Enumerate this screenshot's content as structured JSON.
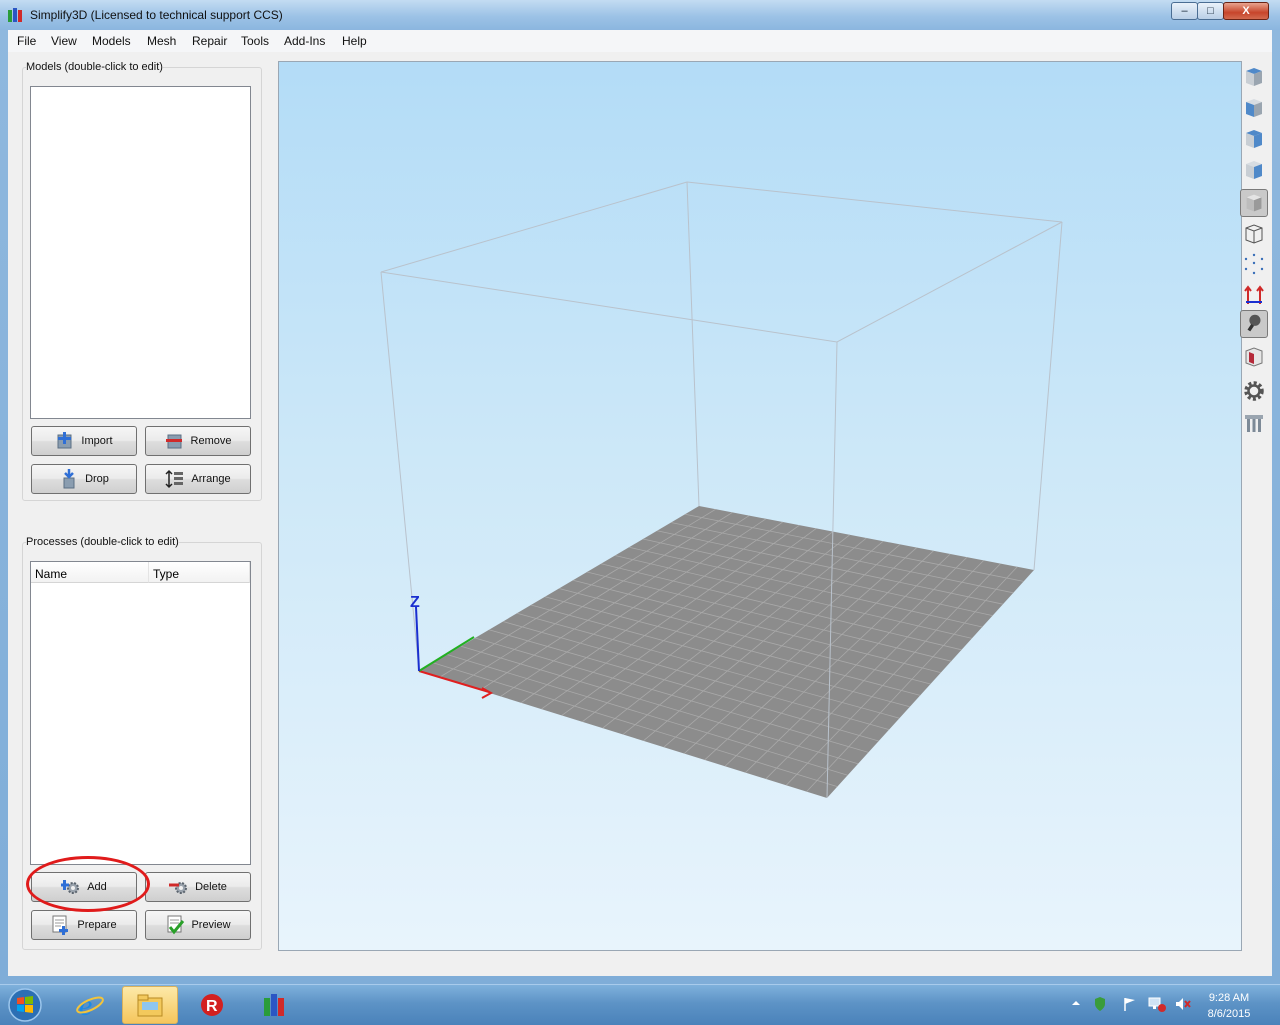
{
  "window": {
    "title": "Simplify3D (Licensed to technical support CCS)",
    "controls": {
      "minimize": "–",
      "maximize": "□",
      "close": "X"
    }
  },
  "menu": [
    "File",
    "View",
    "Models",
    "Mesh",
    "Repair",
    "Tools",
    "Add-Ins",
    "Help"
  ],
  "models_panel": {
    "title": "Models (double-click to edit)",
    "buttons": {
      "import": "Import",
      "remove": "Remove",
      "drop": "Drop",
      "arrange": "Arrange"
    }
  },
  "processes_panel": {
    "title": "Processes (double-click to edit)",
    "columns": [
      "Name",
      "Type"
    ],
    "buttons": {
      "add": "Add",
      "delete": "Delete",
      "prepare": "Prepare",
      "preview": "Preview"
    }
  },
  "viewport": {
    "axis_label": "Z",
    "colors": {
      "bed": "#8c8c8c",
      "grid": "#a9a9a9",
      "x_axis": "#e02020",
      "y_axis": "#22b022",
      "z_axis": "#1a2fd0",
      "box": "#b9c2cc"
    }
  },
  "toolbar_icons": [
    "view-top-icon",
    "view-front-icon",
    "view-side-icon",
    "view-iso-icon",
    "solid-mode-icon",
    "wireframe-mode-icon",
    "point-mode-icon",
    "axes-icon",
    "lighting-icon",
    "section-icon",
    "settings-gear-icon",
    "support-icon"
  ],
  "taskbar": {
    "clock_time": "9:28 AM",
    "clock_date": "8/6/2015"
  }
}
